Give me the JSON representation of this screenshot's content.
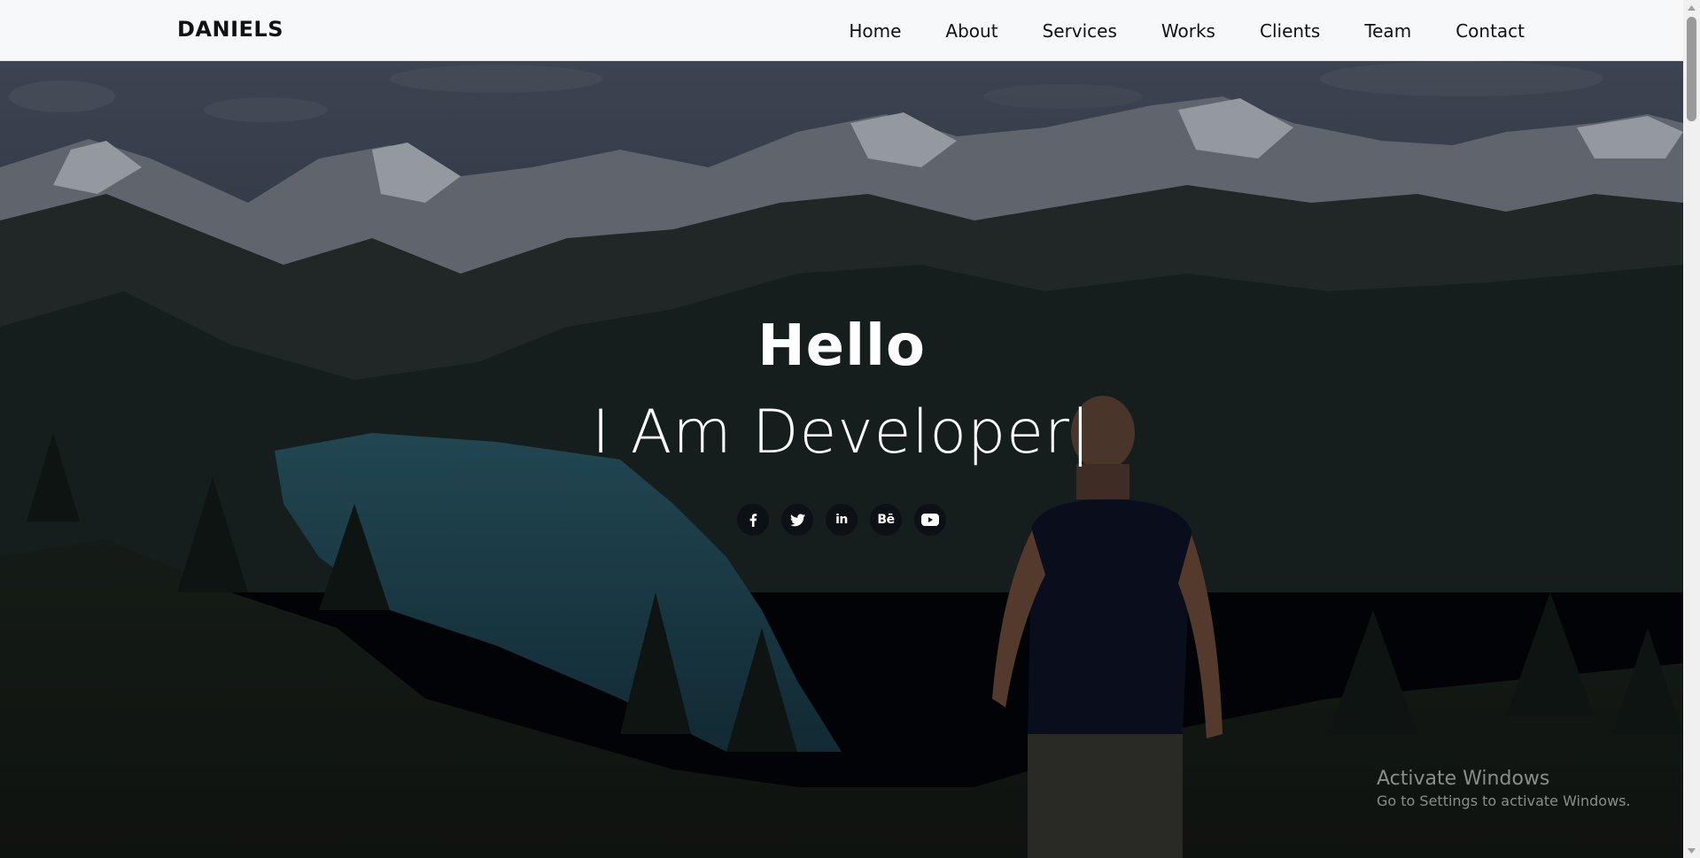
{
  "navbar": {
    "brand": "DANIELS",
    "links": [
      "Home",
      "About",
      "Services",
      "Works",
      "Clients",
      "Team",
      "Contact"
    ]
  },
  "hero": {
    "title": "Hello",
    "subtitle": "I Am Developer",
    "cursor": "|",
    "socials": [
      {
        "icon": "facebook-icon"
      },
      {
        "icon": "twitter-icon"
      },
      {
        "icon": "linkedin-icon",
        "text": "in"
      },
      {
        "icon": "behance-icon",
        "text": "Bē"
      },
      {
        "icon": "youtube-icon"
      }
    ]
  },
  "watermark": {
    "title": "Activate Windows",
    "subtitle": "Go to Settings to activate Windows."
  },
  "colors": {
    "navbar_bg": "#f7f8fa",
    "hero_text": "#ffffff",
    "social_bg": "#0a0c12"
  }
}
